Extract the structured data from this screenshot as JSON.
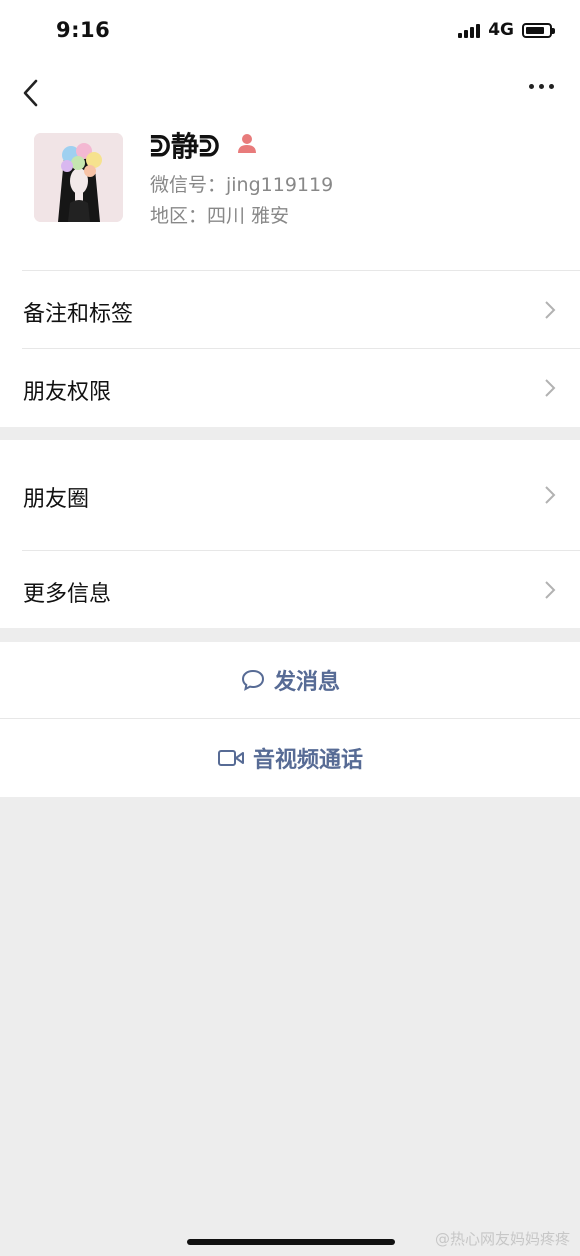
{
  "status": {
    "time": "9:16",
    "network": "4G"
  },
  "icons": {
    "back": "chevron-left-icon",
    "more": "more-dots-icon",
    "gender": "female-icon",
    "chat": "chat-bubble-icon",
    "video": "video-camera-icon"
  },
  "colors": {
    "link": "#576b95",
    "gender": "#e87b7b",
    "background": "#ededed"
  },
  "profile": {
    "name": "ᕲ静ᕲ",
    "wechat_id": "微信号：jing119119",
    "region": "地区：四川 雅安"
  },
  "menu": [
    {
      "label": "备注和标签"
    },
    {
      "label": "朋友权限"
    },
    {
      "label": "朋友圈"
    },
    {
      "label": "更多信息"
    }
  ],
  "actions": {
    "message": "发消息",
    "call": "音视频通话"
  },
  "watermark": "@热心网友妈妈疼疼"
}
